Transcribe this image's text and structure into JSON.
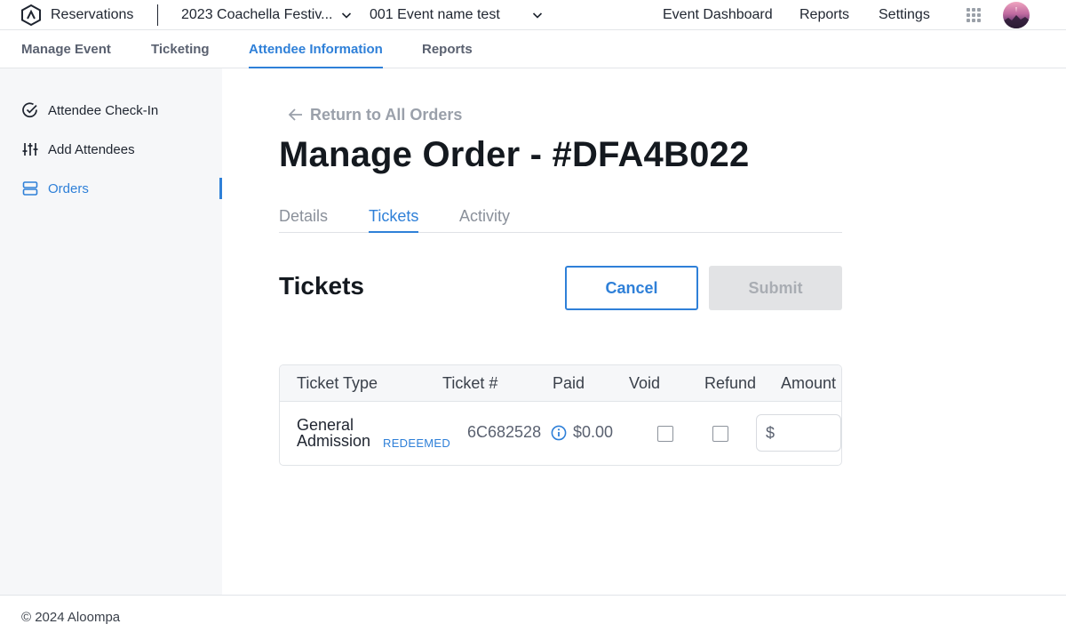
{
  "topbar": {
    "brand": "Reservations",
    "festival_select": "2023 Coachella Festiv...",
    "event_select": "001 Event name test",
    "nav": [
      "Event Dashboard",
      "Reports",
      "Settings"
    ]
  },
  "subnav": {
    "tabs": [
      "Manage Event",
      "Ticketing",
      "Attendee Information",
      "Reports"
    ],
    "active": "Attendee Information"
  },
  "sidebar": {
    "items": [
      "Attendee Check-In",
      "Add Attendees",
      "Orders"
    ],
    "active": "Orders"
  },
  "main": {
    "back_link": "Return to All Orders",
    "title": "Manage Order - #DFA4B022",
    "tabs": [
      "Details",
      "Tickets",
      "Activity"
    ],
    "active_tab": "Tickets",
    "section_title": "Tickets",
    "cancel_label": "Cancel",
    "submit_label": "Submit",
    "table": {
      "columns": [
        "Ticket Type",
        "Ticket #",
        "Paid",
        "Void",
        "Refund",
        "Amount"
      ],
      "rows": [
        {
          "type_line1": "General",
          "type_line2": "Admission",
          "badge": "REDEEMED",
          "ticket_number": "6C682528",
          "paid": "$0.00",
          "void": false,
          "refund": false,
          "amount_currency": "$",
          "amount_value": ""
        }
      ]
    }
  },
  "footer": {
    "copyright": "© 2024 Aloompa"
  },
  "colors": {
    "accent": "#2f80d8",
    "text_dark": "#14191f",
    "muted": "#9aa0aa",
    "disabled_bg": "#e2e3e5"
  }
}
